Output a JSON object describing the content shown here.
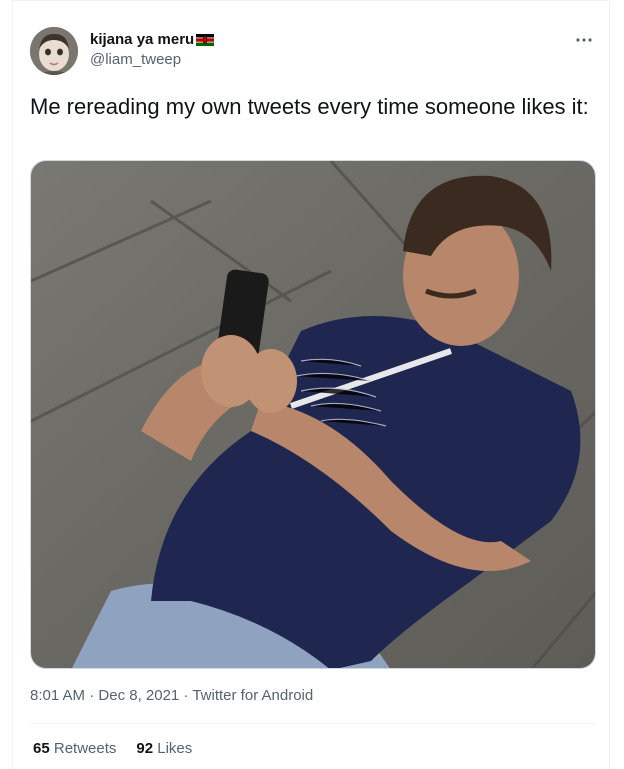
{
  "tweet": {
    "author": {
      "display_name": "kijana ya meru",
      "flag_icon": "kenya-flag-icon",
      "handle": "@liam_tweep"
    },
    "more_icon": "more-horizontal-icon",
    "text": "Me rereading my own tweets every time someone likes it:",
    "media": {
      "description_icon": "photo"
    },
    "timestamp": {
      "time": "8:01 AM",
      "sep1": " · ",
      "date": "Dec 8, 2021",
      "sep2": " · ",
      "source": "Twitter for Android"
    },
    "stats": {
      "retweets_count": "65",
      "retweets_label": "Retweets",
      "likes_count": "92",
      "likes_label": "Likes"
    }
  },
  "colors": {
    "text_primary": "#0f1419",
    "text_secondary": "#536471",
    "border": "#eff3f4"
  }
}
